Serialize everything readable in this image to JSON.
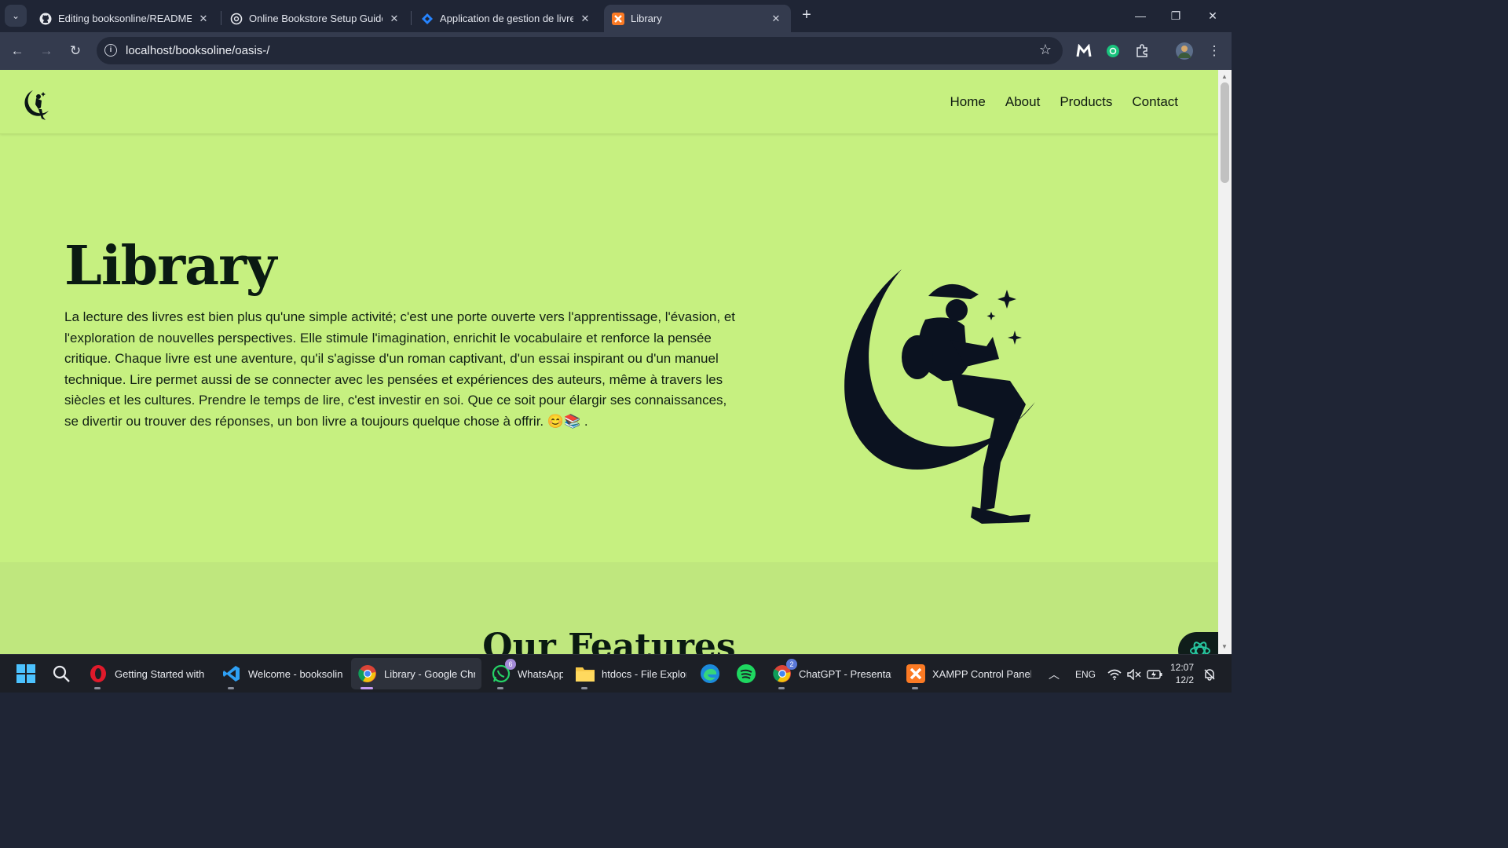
{
  "browser": {
    "tabs": [
      {
        "title": "Editing booksonline/README.md",
        "icon": "github-icon"
      },
      {
        "title": "Online Bookstore Setup Guide",
        "icon": "chatgpt-icon"
      },
      {
        "title": "Application de gestion de livres",
        "icon": "jira-icon"
      },
      {
        "title": "Library",
        "icon": "xampp-icon",
        "active": true
      }
    ],
    "url": "localhost/booksoline/oasis-/"
  },
  "site": {
    "nav": [
      "Home",
      "About",
      "Products",
      "Contact"
    ],
    "hero": {
      "title": "Library",
      "text": "La lecture des livres est bien plus qu'une simple activité; c'est une porte ouverte vers l'apprentissage, l'évasion, et l'exploration de nouvelles perspectives. Elle stimule l'imagination, enrichit le vocabulaire et renforce la pensée critique. Chaque livre est une aventure, qu'il s'agisse d'un roman captivant, d'un essai inspirant ou d'un manuel technique. Lire permet aussi de se connecter avec les pensées et expériences des auteurs, même à travers les siècles et les cultures. Prendre le temps de lire, c'est investir en soi. Que ce soit pour élargir ses connaissances, se divertir ou trouver des réponses, un bon livre a toujours quelque chose à offrir. 😊📚 ."
    },
    "features_title": "Our Features"
  },
  "taskbar": {
    "apps": [
      {
        "label": "Getting Started with F",
        "icon": "opera-icon"
      },
      {
        "label": "Welcome - booksoline",
        "icon": "vscode-icon"
      },
      {
        "label": "Library - Google Chro",
        "icon": "chrome-icon",
        "active": true
      },
      {
        "label": "WhatsApp",
        "icon": "whatsapp-icon",
        "badge": "6"
      },
      {
        "label": "htdocs - File Explor",
        "icon": "folder-icon"
      },
      {
        "label": "ChatGPT - Presentatic",
        "icon": "chrome-icon",
        "badge": "2"
      },
      {
        "label": "XAMPP Control Panel",
        "icon": "xampp-icon"
      }
    ],
    "language": "ENG",
    "time": "12:07",
    "date": "12/2"
  },
  "colors": {
    "page_bg": "#c6f080",
    "features_bg": "#bfe77e",
    "chrome_dark": "#1f2535",
    "toolbar": "#343b4e"
  }
}
